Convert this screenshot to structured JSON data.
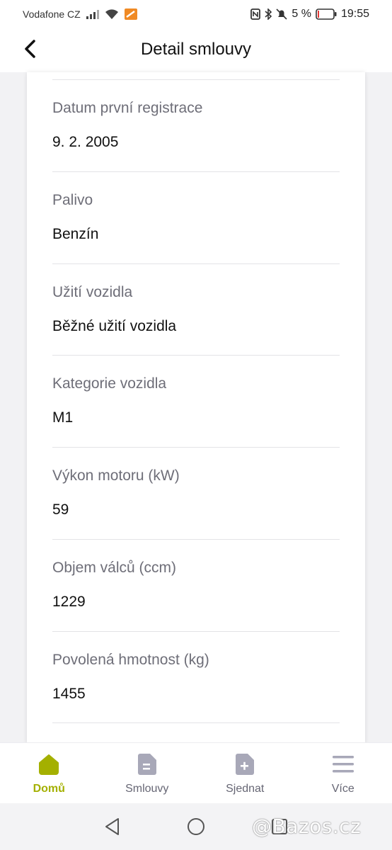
{
  "status_bar": {
    "carrier": "Vodafone CZ",
    "battery": "5 %",
    "time": "19:55"
  },
  "header": {
    "title": "Detail smlouvy"
  },
  "fields": [
    {
      "label": "Datum první registrace",
      "value": "9. 2. 2005"
    },
    {
      "label": "Palivo",
      "value": "Benzín"
    },
    {
      "label": "Užití vozidla",
      "value": "Běžné užití vozidla"
    },
    {
      "label": "Kategorie vozidla",
      "value": "M1"
    },
    {
      "label": "Výkon motoru (kW)",
      "value": "59"
    },
    {
      "label": "Objem válců (ccm)",
      "value": "1229"
    },
    {
      "label": "Povolená hmotnost (kg)",
      "value": "1455"
    }
  ],
  "bottom_nav": {
    "items": [
      {
        "label": "Domů",
        "icon": "home-icon",
        "active": true
      },
      {
        "label": "Smlouvy",
        "icon": "document-icon",
        "active": false
      },
      {
        "label": "Sjednat",
        "icon": "document-add-icon",
        "active": false
      },
      {
        "label": "Více",
        "icon": "menu-icon",
        "active": false
      }
    ]
  },
  "colors": {
    "accent": "#a4b000",
    "inactive_icon": "#a8a8b8"
  },
  "watermark": "@Bazos.cz"
}
